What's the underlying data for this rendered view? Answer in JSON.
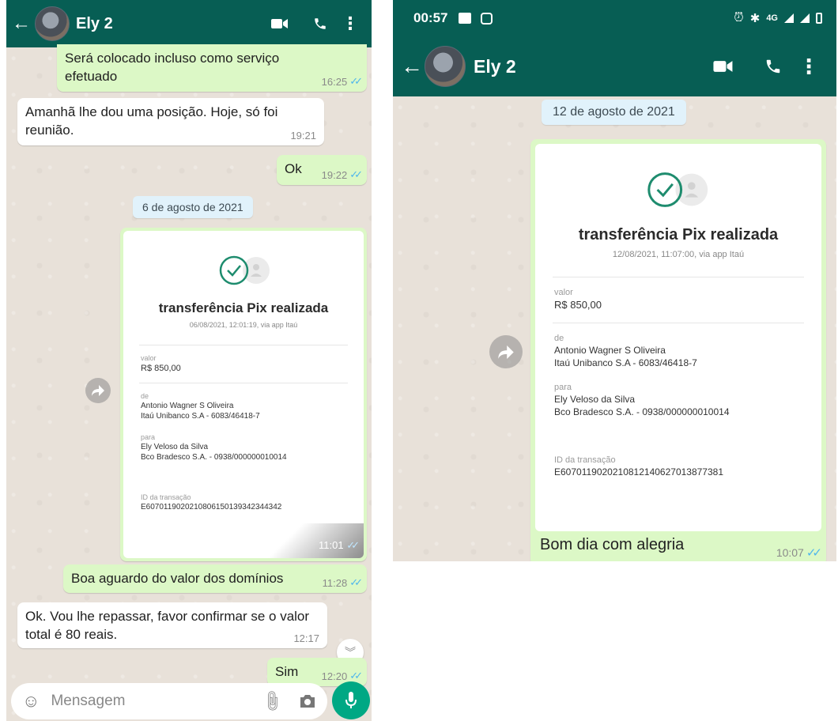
{
  "left": {
    "header": {
      "contact_name": "Ely 2"
    },
    "messages": {
      "m1_text": "Será colocado incluso como serviço efetuado",
      "m1_time": "16:25",
      "m2_text": "Amanhã lhe dou uma posição. Hoje, só foi reunião.",
      "m2_time": "19:21",
      "m3_text": "Ok",
      "m3_time": "19:22",
      "m5_text": "Boa aguardo do valor dos domínios",
      "m5_time": "11:28",
      "m6_text": "Ok. Vou lhe repassar, favor confirmar se o valor total é 80 reais.",
      "m6_time": "12:17",
      "m7_text": "Sim",
      "m7_time": "12:20"
    },
    "date_chip": "6 de agosto de 2021",
    "receipt": {
      "title": "transferência Pix realizada",
      "subtitle": "06/08/2021, 12:01:19, via app Itaú",
      "valor_label": "valor",
      "valor": "R$ 850,00",
      "de_label": "de",
      "de_name": "Antonio Wagner S Oliveira",
      "de_bank": "Itaú Unibanco S.A - 6083/46418-7",
      "para_label": "para",
      "para_name": "Ely Veloso da Silva",
      "para_bank": "Bco Bradesco S.A. - 0938/000000010014",
      "id_label": "ID da transação",
      "id_value": "E60701190202108061501393423443​42",
      "time": "11:01"
    },
    "input": {
      "placeholder": "Mensagem"
    }
  },
  "right": {
    "status": {
      "time": "00:57",
      "network": "4G"
    },
    "header": {
      "contact_name": "Ely 2"
    },
    "date_chip": "12 de agosto de 2021",
    "receipt": {
      "title": "transferência Pix realizada",
      "subtitle": "12/08/2021, 11:07:00, via app Itaú",
      "valor_label": "valor",
      "valor": "R$ 850,00",
      "de_label": "de",
      "de_name": "Antonio Wagner S Oliveira",
      "de_bank": "Itaú Unibanco S.A - 6083/46418-7",
      "para_label": "para",
      "para_name": "Ely Veloso da Silva",
      "para_bank": "Bco Bradesco S.A. - 0938/000000010014",
      "id_label": "ID da transação",
      "id_value": "E60701190202108121406270138773​81"
    },
    "caption": {
      "text": "Bom dia com alegria",
      "time": "10:07"
    }
  },
  "colors": {
    "header": "#075e54",
    "outgoing": "#dcf8c6",
    "incoming": "#ffffff",
    "tick": "#4fb6ec",
    "mic": "#00a884",
    "check": "#1e8c6e"
  }
}
